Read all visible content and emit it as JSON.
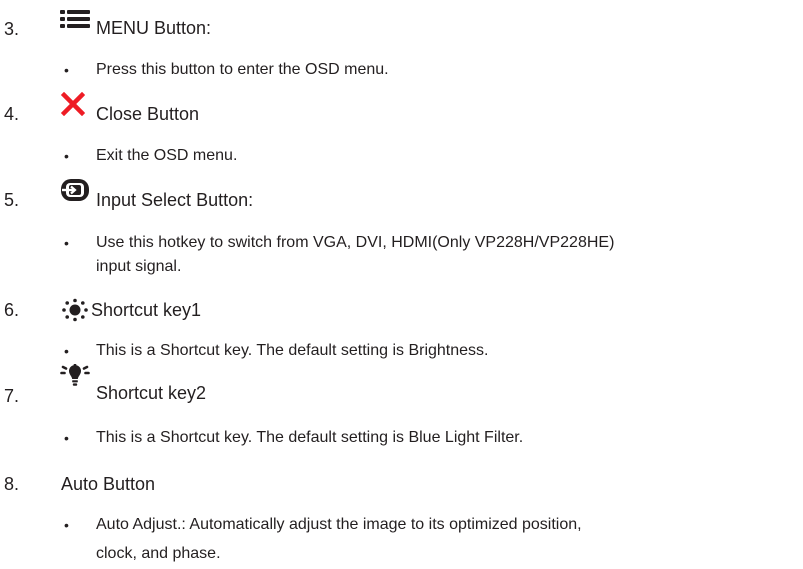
{
  "items": [
    {
      "number": "3.",
      "icon": "menu-icon",
      "title": "MENU Button:",
      "bullets": [
        [
          "Press this button to enter the OSD menu."
        ]
      ]
    },
    {
      "number": "4.",
      "icon": "close-x-icon",
      "icon_color": "#ee1c25",
      "title": "Close Button",
      "bullets": [
        [
          "Exit the OSD menu."
        ]
      ]
    },
    {
      "number": "5.",
      "icon": "input-select-icon",
      "title": "Input Select Button:",
      "bullets": [
        [
          "Use this hotkey to switch from VGA, DVI, HDMI(Only VP228H/VP228HE)",
          "input signal."
        ]
      ]
    },
    {
      "number": "6.",
      "icon": "brightness-sun-icon",
      "title": "Shortcut key1",
      "bullets": [
        [
          "This is a Shortcut key. The default setting is Brightness."
        ]
      ]
    },
    {
      "number": "7.",
      "icon": "blue-light-bulb-icon",
      "title": "Shortcut key2",
      "bullets": [
        [
          "This is a Shortcut key. The default setting is Blue Light Filter."
        ]
      ]
    },
    {
      "number": "8.",
      "title": "Auto Button",
      "bullets": [
        [
          "Auto Adjust.: Automatically adjust the image to its optimized position,",
          "clock, and phase."
        ]
      ]
    }
  ]
}
